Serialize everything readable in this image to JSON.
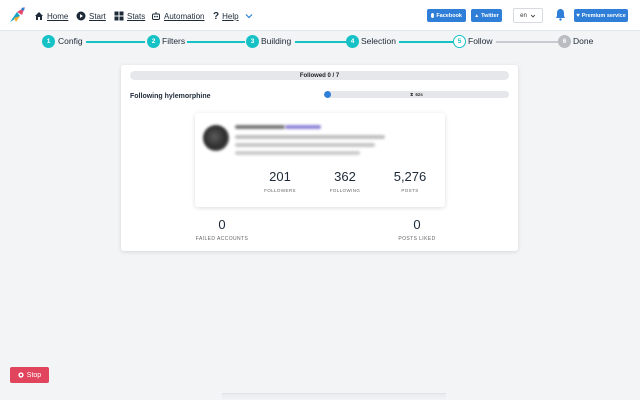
{
  "navbar": {
    "items": [
      {
        "label": "Home",
        "icon": "home-icon"
      },
      {
        "label": "Start",
        "icon": "play-circle-icon"
      },
      {
        "label": "Stats",
        "icon": "grid-icon"
      },
      {
        "label": "Automation",
        "icon": "robot-icon"
      },
      {
        "label": "Help",
        "icon": "question-icon"
      }
    ],
    "facebook_label": "Facebook",
    "twitter_label": "Twitter",
    "language": "en",
    "premium_label": "Premium service"
  },
  "stepper": {
    "steps": [
      {
        "number": "1",
        "label": "Config",
        "state": "done"
      },
      {
        "number": "2",
        "label": "Filters",
        "state": "done"
      },
      {
        "number": "3",
        "label": "Building",
        "state": "done"
      },
      {
        "number": "4",
        "label": "Selection",
        "state": "done"
      },
      {
        "number": "5",
        "label": "Follow",
        "state": "active"
      },
      {
        "number": "6",
        "label": "Done",
        "state": "pending"
      }
    ],
    "colors": {
      "done": "#16c2c6",
      "pending": "#b9bdc2"
    }
  },
  "progress": {
    "followed_text": "Followed 0 / 7",
    "following_text": "Following hylemorphine",
    "timer_text": "62s",
    "timer_fraction": 0.04
  },
  "profile": {
    "followers_value": "201",
    "followers_label": "FOLLOWERS",
    "following_value": "362",
    "following_label": "FOLLOWING",
    "posts_value": "5,276",
    "posts_label": "POSTS"
  },
  "summary": {
    "failed_value": "0",
    "failed_label": "FAILED ACCOUNTS",
    "liked_value": "0",
    "liked_label": "POSTS LIKED"
  },
  "stop_label": "Stop",
  "colors": {
    "accent": "#2f7fd8",
    "stop": "#e0455d",
    "teal": "#16c2c6"
  }
}
